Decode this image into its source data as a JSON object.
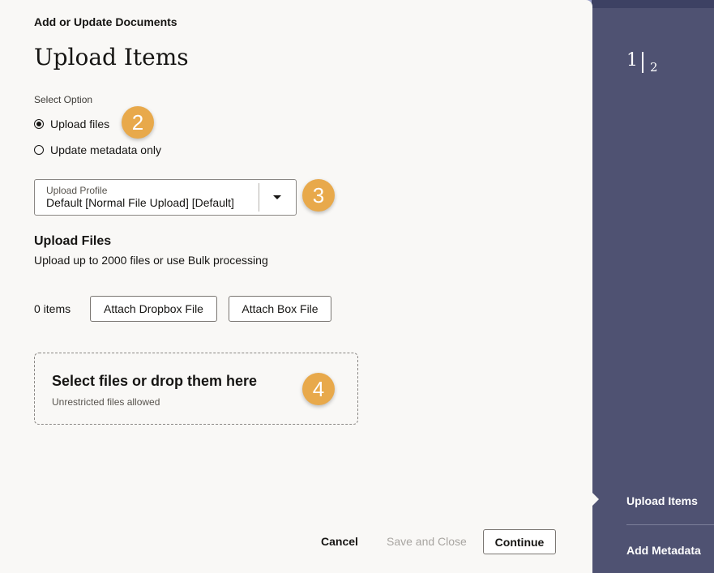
{
  "dialog": {
    "subtitle": "Add or Update Documents",
    "title": "Upload Items"
  },
  "select_option": {
    "label": "Select Option",
    "options": [
      {
        "label": "Upload files",
        "selected": true
      },
      {
        "label": "Update metadata only",
        "selected": false
      }
    ]
  },
  "upload_profile": {
    "label": "Upload Profile",
    "value": "Default [Normal File Upload] [Default]"
  },
  "upload_files": {
    "title": "Upload Files",
    "subtitle": "Upload up to 2000 files or use Bulk processing",
    "item_count": "0 items",
    "dropbox_button": "Attach Dropbox File",
    "box_button": "Attach Box File"
  },
  "dropzone": {
    "heading": "Select files or drop them here",
    "note": "Unrestricted files allowed"
  },
  "callouts": [
    "2",
    "3",
    "4"
  ],
  "footer": {
    "cancel": "Cancel",
    "save_close": "Save and Close",
    "continue": "Continue"
  },
  "train": {
    "current": "1",
    "total": "2",
    "steps": [
      "Upload Items",
      "Add Metadata"
    ]
  },
  "colors": {
    "panel": "#f9f8f6",
    "sidebar": "#4f5272",
    "badge": "#e8a94b"
  }
}
